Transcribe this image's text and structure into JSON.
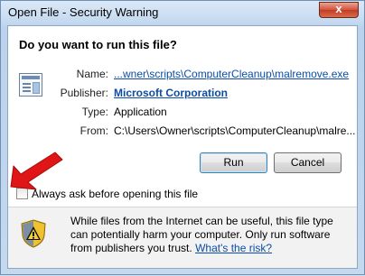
{
  "window": {
    "title": "Open File - Security Warning",
    "close_glyph": "x"
  },
  "dialog": {
    "question": "Do you want to run this file?",
    "fields": {
      "name_label": "Name:",
      "name_value": "...wner\\scripts\\ComputerCleanup\\malremove.exe",
      "publisher_label": "Publisher:",
      "publisher_value": "Microsoft Corporation",
      "type_label": "Type:",
      "type_value": "Application",
      "from_label": "From:",
      "from_value": "C:\\Users\\Owner\\scripts\\ComputerCleanup\\malre..."
    },
    "buttons": {
      "run": "Run",
      "cancel": "Cancel"
    },
    "checkbox": {
      "label": "Always ask before opening this file",
      "checked": false
    },
    "warning": {
      "text": "While files from the Internet can be useful, this file type can potentially harm your computer. Only run software from publishers you trust.",
      "link": "What's the risk?"
    }
  },
  "icons": {
    "file": "application-file-icon",
    "shield": "security-shield-icon",
    "arrow": "red-arrow-icon"
  },
  "colors": {
    "link": "#0b4da6",
    "arrow": "#e01515"
  }
}
